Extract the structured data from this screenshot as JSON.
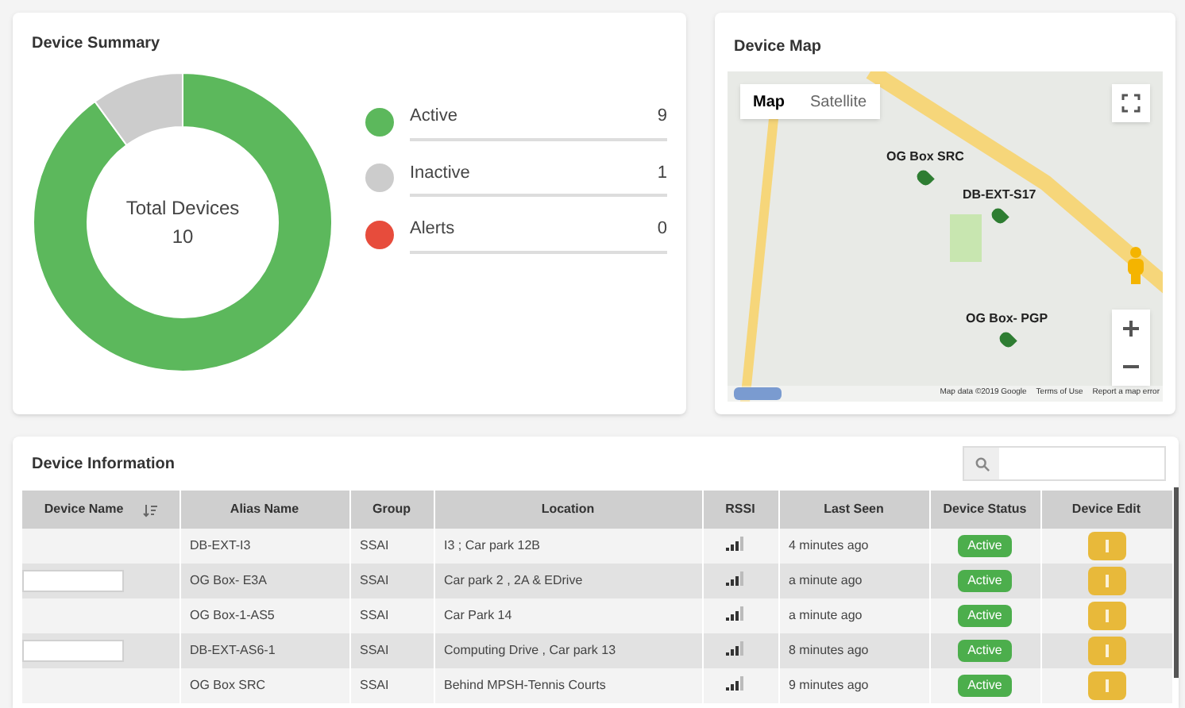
{
  "summary": {
    "title": "Device Summary",
    "center_label": "Total Devices",
    "center_value": "10",
    "legend": [
      {
        "label": "Active",
        "count": "9",
        "color": "#5cb85c"
      },
      {
        "label": "Inactive",
        "count": "1",
        "color": "#cccccc"
      },
      {
        "label": "Alerts",
        "count": "0",
        "color": "#e74c3c"
      }
    ]
  },
  "map": {
    "title": "Device Map",
    "tabs": [
      {
        "label": "Map",
        "selected": true
      },
      {
        "label": "Satellite",
        "selected": false
      }
    ],
    "markers": [
      {
        "label": "OG Box SRC"
      },
      {
        "label": "DB-EXT-S17"
      },
      {
        "label": "OG Box- PGP"
      }
    ],
    "footer": [
      "Map data ©2019 Google",
      "Terms of Use",
      "Report a map error"
    ]
  },
  "table": {
    "title": "Device Information",
    "columns": [
      "Device Name",
      "Alias Name",
      "Group",
      "Location",
      "RSSI",
      "Last Seen",
      "Device Status",
      "Device Edit"
    ],
    "rows": [
      {
        "alias": "DB-EXT-I3",
        "group": "SSAI",
        "location": "I3 ; Car park 12B",
        "last_seen": "4 minutes ago",
        "status": "Active"
      },
      {
        "alias": "OG Box- E3A",
        "group": "SSAI",
        "location": "Car park 2 , 2A & EDrive",
        "last_seen": "a minute ago",
        "status": "Active"
      },
      {
        "alias": "OG Box-1-AS5",
        "group": "SSAI",
        "location": "Car Park 14",
        "last_seen": "a minute ago",
        "status": "Active"
      },
      {
        "alias": "DB-EXT-AS6-1",
        "group": "SSAI",
        "location": "Computing Drive , Car park 13",
        "last_seen": "8 minutes ago",
        "status": "Active"
      },
      {
        "alias": "OG Box SRC",
        "group": "SSAI",
        "location": "Behind MPSH-Tennis Courts",
        "last_seen": "9 minutes ago",
        "status": "Active"
      }
    ]
  }
}
